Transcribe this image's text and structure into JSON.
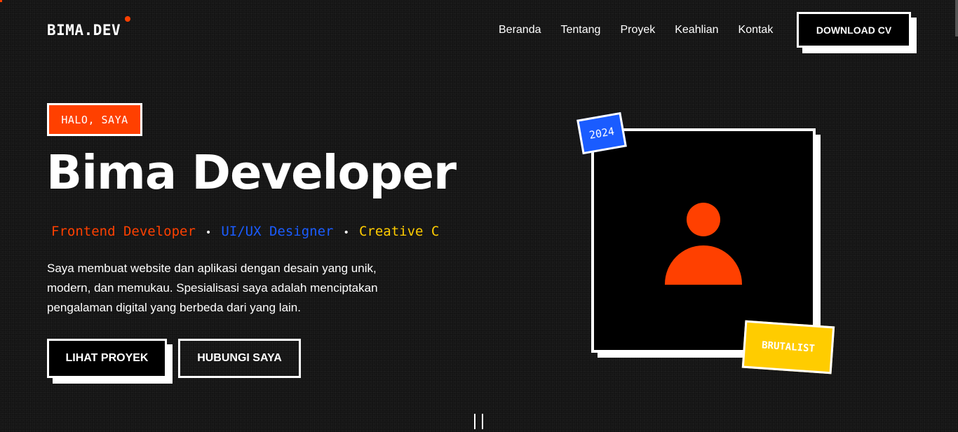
{
  "nav": {
    "logo": "BIMA.DEV",
    "links": [
      "Beranda",
      "Tentang",
      "Proyek",
      "Keahlian",
      "Kontak"
    ],
    "cta": "DOWNLOAD CV"
  },
  "hero": {
    "greeting": "HALO, SAYA",
    "title": "Bima Developer",
    "roles": [
      "Frontend Developer",
      "UI/UX Designer",
      "Creative C"
    ],
    "separator": "•",
    "description": "Saya membuat website dan aplikasi dengan desain yang unik, modern, dan memukau. Spesialisasi saya adalah menciptakan pengalaman digital yang berbeda dari yang lain.",
    "primary_button": "LIHAT PROYEK",
    "secondary_button": "HUBUNGI SAYA"
  },
  "card": {
    "year_badge": "2024",
    "style_badge": "BRUTALIST",
    "avatar_icon": "user-icon"
  },
  "colors": {
    "background": "#141414",
    "accent": "#ff4000",
    "blue": "#1a5cff",
    "yellow": "#ffcc00"
  }
}
